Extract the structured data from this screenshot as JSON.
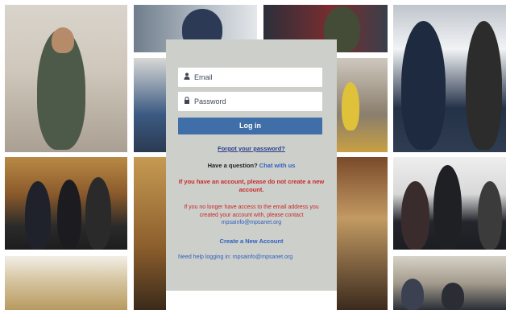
{
  "login_form": {
    "email_placeholder": "Email",
    "password_placeholder": "Password",
    "login_label": "Log in",
    "forgot_label": "Forgot your password?",
    "question_text": "Have a question?",
    "chat_label": "Chat with us",
    "warning_text": "If you have an account, please do not create a new account.",
    "no_access_text": "If you no longer have access to the email address you created your account with, please contact",
    "no_access_email": "mpsainfo@mpsanet.org",
    "create_label": "Create a New Account",
    "help_text": "Need help logging in:",
    "help_email": "mpsainfo@mpsanet.org"
  },
  "icons": {
    "email": "person-icon",
    "password": "lock-icon"
  },
  "colors": {
    "panel_bg": "#cdcfca",
    "button_bg": "#3f6ea8",
    "link": "#2f5fc0",
    "warning": "#c8282a"
  }
}
